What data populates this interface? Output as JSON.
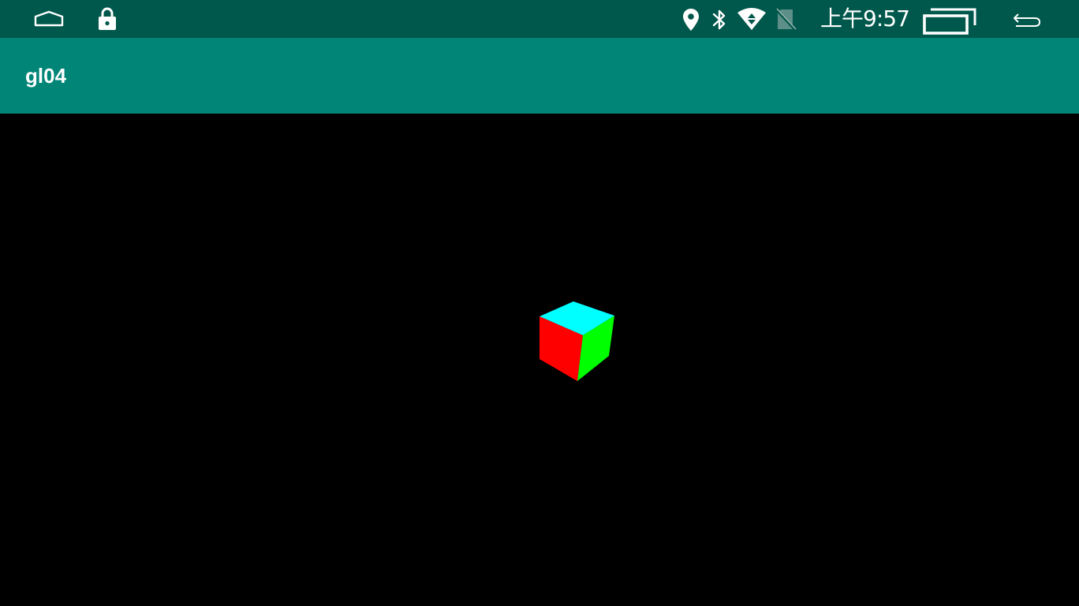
{
  "status_bar": {
    "time": "上午9:57",
    "icons": [
      "home-icon",
      "lock-icon",
      "location-icon",
      "bluetooth-icon",
      "wifi-icon",
      "no-sim-icon",
      "recent-apps-icon",
      "back-icon"
    ]
  },
  "app_bar": {
    "title": "gl04"
  },
  "scene": {
    "cube_faces": {
      "top": "#00ffff",
      "front": "#ff0000",
      "right": "#00ff00"
    }
  },
  "colors": {
    "status_bar": "#00574b",
    "app_bar": "#008577",
    "surface": "#000000"
  }
}
